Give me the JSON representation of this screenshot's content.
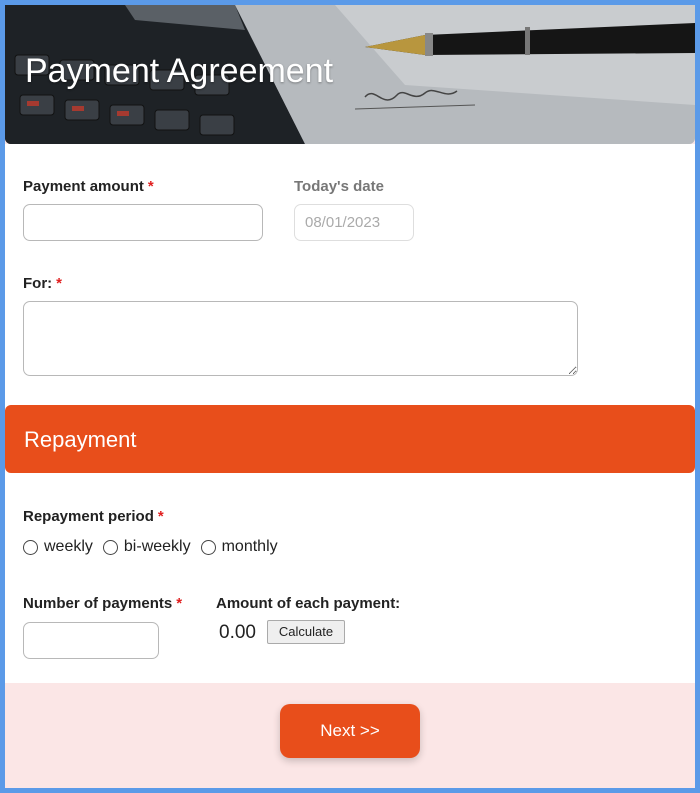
{
  "header": {
    "title": "Payment Agreement"
  },
  "form": {
    "payment_amount": {
      "label": "Payment amount",
      "required": "*",
      "value": ""
    },
    "todays_date": {
      "label": "Today's date",
      "value": "08/01/2023"
    },
    "for_field": {
      "label": "For:",
      "required": "*",
      "value": ""
    }
  },
  "repayment": {
    "section_title": "Repayment",
    "period": {
      "label": "Repayment period",
      "required": "*",
      "options": [
        "weekly",
        "bi-weekly",
        "monthly"
      ]
    },
    "number_of_payments": {
      "label": "Number of payments",
      "required": "*",
      "value": ""
    },
    "amount_each": {
      "label": "Amount of each payment:",
      "value": "0.00",
      "calculate_label": "Calculate"
    }
  },
  "footer": {
    "next_label": "Next >>"
  },
  "colors": {
    "accent": "#e84e1b",
    "frame": "#5b9ae8",
    "footer_bg": "#fbe6e6",
    "required": "#e02020"
  }
}
